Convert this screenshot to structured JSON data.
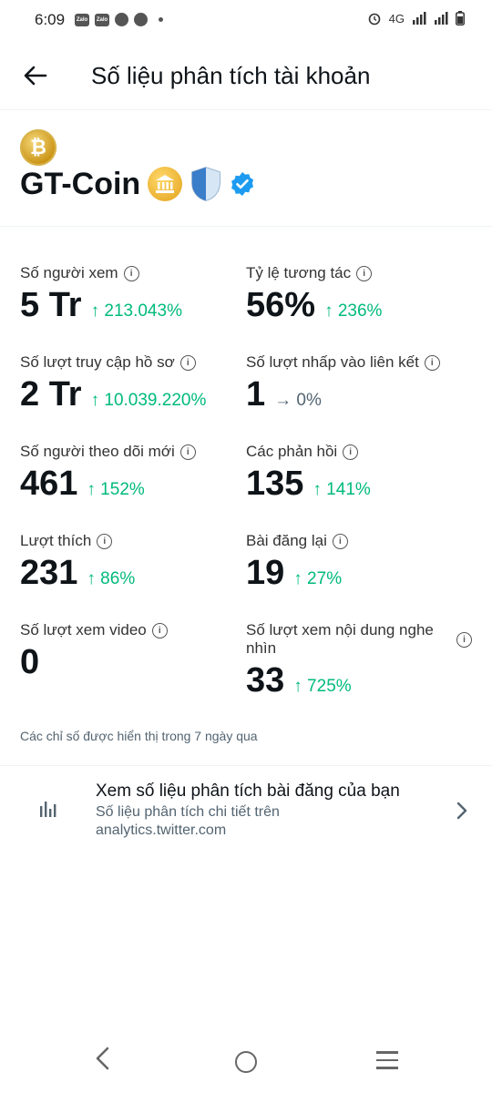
{
  "status_bar": {
    "time": "6:09",
    "network": "4G",
    "app_icons": [
      "Zalo",
      "Zalo"
    ]
  },
  "header": {
    "title": "Số liệu phân tích tài khoản"
  },
  "profile": {
    "name": "GT-Coin",
    "avatar_glyph": "₿"
  },
  "stats": [
    {
      "label": "Số người xem",
      "value": "5 Tr",
      "change": "↑ 213.043%"
    },
    {
      "label": "Tỷ lệ tương tác",
      "value": "56%",
      "change": "↑ 236%"
    },
    {
      "label": "Số lượt truy cập hồ sơ",
      "value": "2 Tr",
      "change": "↑ 10.039.220%"
    },
    {
      "label": "Số lượt nhấp vào liên kết",
      "value": "1",
      "change": "→ 0%"
    },
    {
      "label": "Số người theo dõi mới",
      "value": "461",
      "change": "↑ 152%"
    },
    {
      "label": "Các phản hồi",
      "value": "135",
      "change": "↑ 141%"
    },
    {
      "label": "Lượt thích",
      "value": "231",
      "change": "↑ 86%"
    },
    {
      "label": "Bài đăng lại",
      "value": "19",
      "change": "↑ 27%"
    },
    {
      "label": "Số lượt xem video",
      "value": "0",
      "change": ""
    },
    {
      "label": "Số lượt xem nội dung nghe nhìn",
      "value": "33",
      "change": "↑ 725%"
    }
  ],
  "footnote": "Các chỉ số được hiển thị trong 7 ngày qua",
  "post_analytics_link": {
    "title": "Xem số liệu phân tích bài đăng của bạn",
    "description": "Số liệu phân tích chi tiết trên analytics.twitter.com"
  },
  "colors": {
    "positive": "#00ba7c",
    "neutral": "#536471",
    "verified": "#1d9bf0",
    "text": "#0f1419"
  },
  "icons": {
    "back": "arrow-left-icon",
    "info": "info-icon",
    "chart": "bar-chart-icon",
    "chevron": "chevron-right-icon"
  }
}
